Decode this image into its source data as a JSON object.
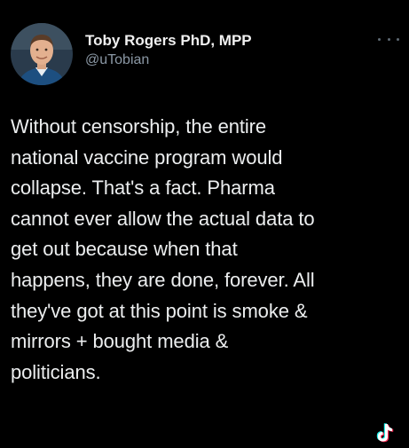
{
  "tweet": {
    "author": {
      "display_name": "Toby Rogers PhD, MPP",
      "handle": "@uTobian"
    },
    "more_icon": "more-horizontal-icon",
    "text_lines": [
      "Without censorship, the entire",
      "national vaccine program would",
      "collapse. That's a fact. Pharma",
      "cannot ever allow the actual data to",
      "get out because when that",
      "happens, they are done, forever. All",
      "they've got at this point is smoke &",
      "mirrors + bought media &",
      "politicians."
    ]
  },
  "watermark": {
    "icon": "tiktok-logo-icon"
  },
  "colors": {
    "background": "#000000",
    "text": "#eceeef",
    "secondary": "#8b98a5"
  }
}
